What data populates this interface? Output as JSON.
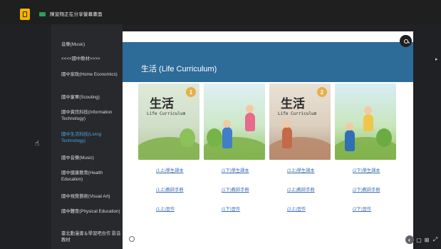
{
  "topbar": {
    "share_text": "陳宣翔正在分享螢幕畫面"
  },
  "sidebar": {
    "items": [
      {
        "label": "音樂(Music)"
      },
      {
        "label": "<<<<國中教材>>>>"
      },
      {
        "label": "國中家政(Home Economics)"
      },
      {
        "label": "國中童軍(Scouting)"
      },
      {
        "label": "國中資訊科技(Information Technology)"
      },
      {
        "label": "國中生活科技(Living Technology)"
      },
      {
        "label": "國中音樂(Music)"
      },
      {
        "label": "國中健康教育(Health Education)"
      },
      {
        "label": "國中視覺藝術(Visual Art)"
      },
      {
        "label": "國中體育(Physical Education)"
      },
      {
        "label": "臺北動漫畫＆學習吧合作 影音教材"
      }
    ],
    "active_index": 5
  },
  "main": {
    "banner_title": "生活 (Life Curriculum)",
    "books": [
      {
        "title": "生活",
        "subtitle": "Life Curriculum",
        "badge": "1"
      },
      {
        "title": "",
        "subtitle": "",
        "badge": ""
      },
      {
        "title": "生活",
        "subtitle": "Life Curriculum",
        "badge": "2"
      },
      {
        "title": "",
        "subtitle": "",
        "badge": ""
      }
    ],
    "link_rows": [
      [
        "(1上)學生課本",
        "(1下)學生課本",
        "(2上)學生課本",
        "(2下)學生課本"
      ],
      [
        "(1上)教師手冊",
        "(1下)教師手冊",
        "(2上)教師手冊",
        "(2下)教師手冊"
      ],
      [
        "(1上)習作",
        "(1下)習作",
        "(2上)習作",
        "(2下)習作"
      ]
    ]
  },
  "controls": {
    "fab_labels": [
      "",
      "",
      "",
      ""
    ]
  },
  "colors": {
    "banner": "#2d6b99",
    "link": "#3b6fb6",
    "active_sidebar": "#4aa3df",
    "share_chip": "#2e9e5b",
    "app_icon": "#f4b400"
  }
}
